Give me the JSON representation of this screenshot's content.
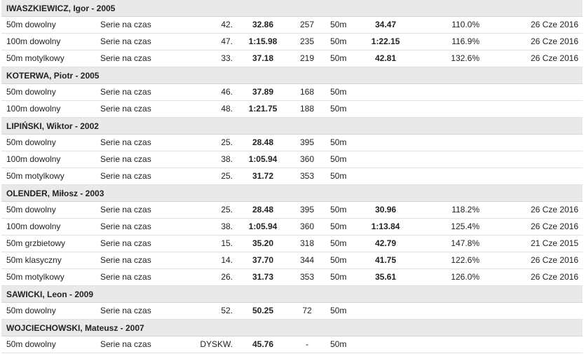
{
  "athletes": [
    {
      "name": "IWASZKIEWICZ, Igor - 2005",
      "rows": [
        {
          "event": "50m dowolny",
          "round": "Serie na czas",
          "place": "42.",
          "time": "32.86",
          "points": "257",
          "pool": "50m",
          "pb": "34.47",
          "pct": "110.0%",
          "date": "26 Cze 2016"
        },
        {
          "event": "100m dowolny",
          "round": "Serie na czas",
          "place": "47.",
          "time": "1:15.98",
          "points": "235",
          "pool": "50m",
          "pb": "1:22.15",
          "pct": "116.9%",
          "date": "26 Cze 2016"
        },
        {
          "event": "50m motylkowy",
          "round": "Serie na czas",
          "place": "33.",
          "time": "37.18",
          "points": "219",
          "pool": "50m",
          "pb": "42.81",
          "pct": "132.6%",
          "date": "26 Cze 2016"
        }
      ]
    },
    {
      "name": "KOTERWA, Piotr - 2005",
      "rows": [
        {
          "event": "50m dowolny",
          "round": "Serie na czas",
          "place": "46.",
          "time": "37.89",
          "points": "168",
          "pool": "50m",
          "pb": "",
          "pct": "",
          "date": ""
        },
        {
          "event": "100m dowolny",
          "round": "Serie na czas",
          "place": "48.",
          "time": "1:21.75",
          "points": "188",
          "pool": "50m",
          "pb": "",
          "pct": "",
          "date": ""
        }
      ]
    },
    {
      "name": "LIPIŃSKI, Wiktor - 2002",
      "rows": [
        {
          "event": "50m dowolny",
          "round": "Serie na czas",
          "place": "25.",
          "time": "28.48",
          "points": "395",
          "pool": "50m",
          "pb": "",
          "pct": "",
          "date": ""
        },
        {
          "event": "100m dowolny",
          "round": "Serie na czas",
          "place": "38.",
          "time": "1:05.94",
          "points": "360",
          "pool": "50m",
          "pb": "",
          "pct": "",
          "date": ""
        },
        {
          "event": "50m motylkowy",
          "round": "Serie na czas",
          "place": "25.",
          "time": "31.72",
          "points": "353",
          "pool": "50m",
          "pb": "",
          "pct": "",
          "date": ""
        }
      ]
    },
    {
      "name": "OLENDER, Miłosz - 2003",
      "rows": [
        {
          "event": "50m dowolny",
          "round": "Serie na czas",
          "place": "25.",
          "time": "28.48",
          "points": "395",
          "pool": "50m",
          "pb": "30.96",
          "pct": "118.2%",
          "date": "26 Cze 2016"
        },
        {
          "event": "100m dowolny",
          "round": "Serie na czas",
          "place": "38.",
          "time": "1:05.94",
          "points": "360",
          "pool": "50m",
          "pb": "1:13.84",
          "pct": "125.4%",
          "date": "26 Cze 2016"
        },
        {
          "event": "50m grzbietowy",
          "round": "Serie na czas",
          "place": "15.",
          "time": "35.20",
          "points": "318",
          "pool": "50m",
          "pb": "42.79",
          "pct": "147.8%",
          "date": "21 Cze 2015"
        },
        {
          "event": "50m klasyczny",
          "round": "Serie na czas",
          "place": "14.",
          "time": "37.70",
          "points": "344",
          "pool": "50m",
          "pb": "41.75",
          "pct": "122.6%",
          "date": "26 Cze 2016"
        },
        {
          "event": "50m motylkowy",
          "round": "Serie na czas",
          "place": "26.",
          "time": "31.73",
          "points": "353",
          "pool": "50m",
          "pb": "35.61",
          "pct": "126.0%",
          "date": "26 Cze 2016"
        }
      ]
    },
    {
      "name": "SAWICKI, Leon - 2009",
      "rows": [
        {
          "event": "50m dowolny",
          "round": "Serie na czas",
          "place": "52.",
          "time": "50.25",
          "points": "72",
          "pool": "50m",
          "pb": "",
          "pct": "",
          "date": ""
        }
      ]
    },
    {
      "name": "WOJCIECHOWSKI, Mateusz - 2007",
      "rows": [
        {
          "event": "50m dowolny",
          "round": "Serie na czas",
          "place": "DYSKW.",
          "time": "45.76",
          "points": "-",
          "pool": "50m",
          "pb": "",
          "pct": "",
          "date": ""
        }
      ]
    }
  ]
}
